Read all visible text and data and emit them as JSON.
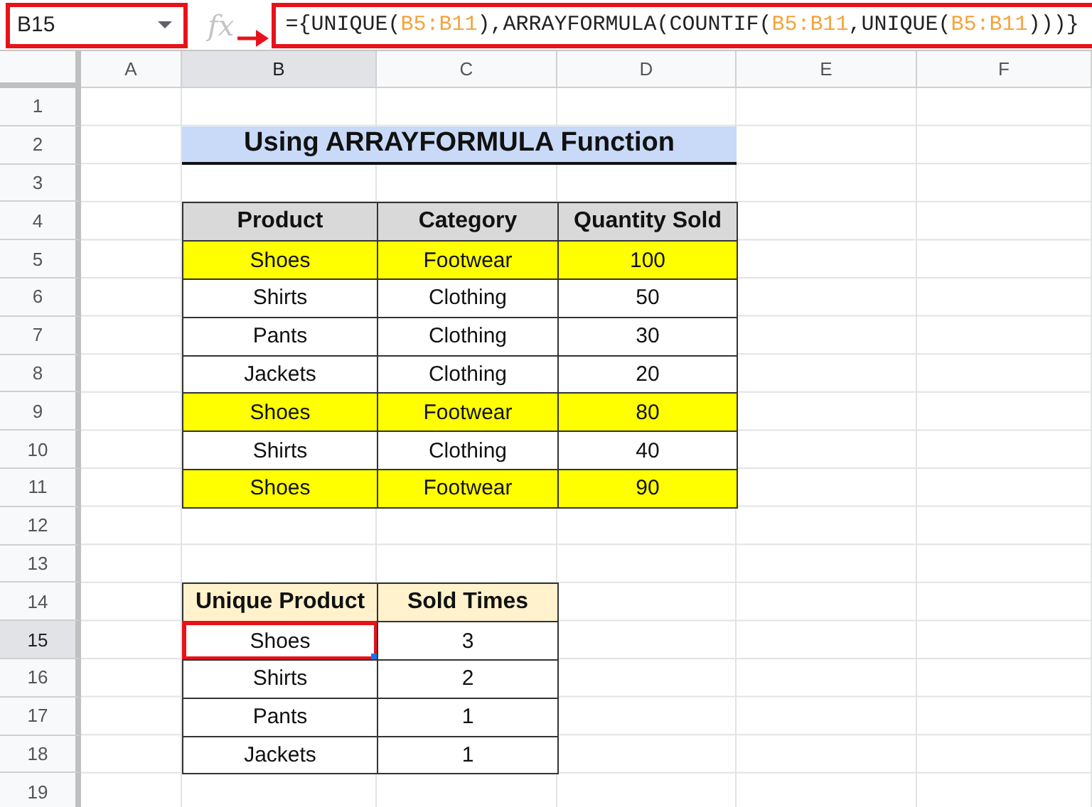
{
  "name_box": {
    "value": "B15"
  },
  "fx_label": "fx",
  "formula": [
    {
      "text": "={UNIQUE(",
      "kind": "plain"
    },
    {
      "text": "B5:B11",
      "kind": "ref"
    },
    {
      "text": "),ARRAYFORMULA(COUNTIF(",
      "kind": "plain"
    },
    {
      "text": "B5:B11",
      "kind": "ref"
    },
    {
      "text": ",UNIQUE(",
      "kind": "plain"
    },
    {
      "text": "B5:B11",
      "kind": "ref"
    },
    {
      "text": ")))}",
      "kind": "plain"
    }
  ],
  "columns": [
    {
      "label": "A",
      "selected": false
    },
    {
      "label": "B",
      "selected": true
    },
    {
      "label": "C",
      "selected": false
    },
    {
      "label": "D",
      "selected": false
    },
    {
      "label": "E",
      "selected": false
    },
    {
      "label": "F",
      "selected": false
    }
  ],
  "rows": [
    {
      "label": "1",
      "selected": false
    },
    {
      "label": "2",
      "selected": false
    },
    {
      "label": "3",
      "selected": false
    },
    {
      "label": "4",
      "selected": false
    },
    {
      "label": "5",
      "selected": false
    },
    {
      "label": "6",
      "selected": false
    },
    {
      "label": "7",
      "selected": false
    },
    {
      "label": "8",
      "selected": false
    },
    {
      "label": "9",
      "selected": false
    },
    {
      "label": "10",
      "selected": false
    },
    {
      "label": "11",
      "selected": false
    },
    {
      "label": "12",
      "selected": false
    },
    {
      "label": "13",
      "selected": false
    },
    {
      "label": "14",
      "selected": false
    },
    {
      "label": "15",
      "selected": true
    },
    {
      "label": "16",
      "selected": false
    },
    {
      "label": "17",
      "selected": false
    },
    {
      "label": "18",
      "selected": false
    },
    {
      "label": "19",
      "selected": false
    }
  ],
  "title": "Using ARRAYFORMULA Function",
  "sales_table": {
    "columns": [
      "Product",
      "Category",
      "Quantity Sold"
    ],
    "rows": [
      {
        "cells": [
          "Shoes",
          "Footwear",
          "100"
        ],
        "highlighted": true
      },
      {
        "cells": [
          "Shirts",
          "Clothing",
          "50"
        ],
        "highlighted": false
      },
      {
        "cells": [
          "Pants",
          "Clothing",
          "30"
        ],
        "highlighted": false
      },
      {
        "cells": [
          "Jackets",
          "Clothing",
          "20"
        ],
        "highlighted": false
      },
      {
        "cells": [
          "Shoes",
          "Footwear",
          "80"
        ],
        "highlighted": true
      },
      {
        "cells": [
          "Shirts",
          "Clothing",
          "40"
        ],
        "highlighted": false
      },
      {
        "cells": [
          "Shoes",
          "Footwear",
          "90"
        ],
        "highlighted": true
      }
    ]
  },
  "result_table": {
    "columns": [
      "Unique Product",
      "Sold Times"
    ],
    "rows": [
      {
        "cells": [
          {
            "text": "Shoes",
            "selected": true
          },
          {
            "text": "3",
            "selected": false
          }
        ]
      },
      {
        "cells": [
          {
            "text": "Shirts",
            "selected": false
          },
          {
            "text": "2",
            "selected": false
          }
        ]
      },
      {
        "cells": [
          {
            "text": "Pants",
            "selected": false
          },
          {
            "text": "1",
            "selected": false
          }
        ]
      },
      {
        "cells": [
          {
            "text": "Jackets",
            "selected": false
          },
          {
            "text": "1",
            "selected": false
          }
        ]
      }
    ]
  }
}
